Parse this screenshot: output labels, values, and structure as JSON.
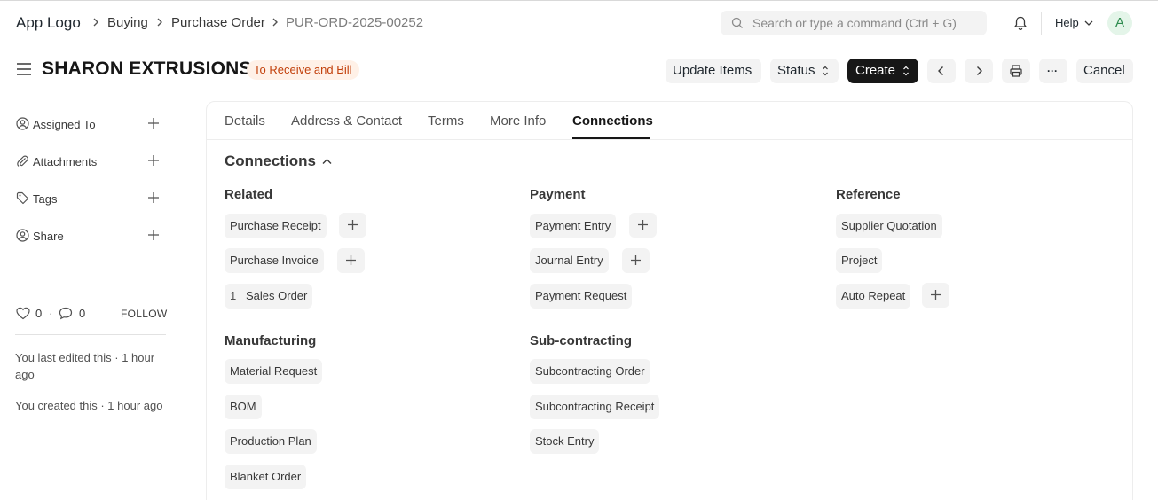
{
  "navbar": {
    "logo": "App Logo",
    "breadcrumbs": [
      "Buying",
      "Purchase Order",
      "PUR-ORD-2025-00252"
    ],
    "search_placeholder": "Search or type a command (Ctrl + G)",
    "help_label": "Help",
    "avatar_initial": "A"
  },
  "header": {
    "title": "SHARON EXTRUSIONS",
    "status": "To Receive and Bill",
    "buttons": {
      "update_items": "Update Items",
      "status": "Status",
      "create": "Create",
      "more": "···",
      "cancel": "Cancel"
    }
  },
  "sidebar": {
    "items": [
      {
        "label": "Assigned To",
        "icon": "assign-user-icon"
      },
      {
        "label": "Attachments",
        "icon": "paperclip-icon"
      },
      {
        "label": "Tags",
        "icon": "tag-icon"
      },
      {
        "label": "Share",
        "icon": "share-user-icon"
      }
    ],
    "likes_count": "0",
    "comments_count": "0",
    "separator": "·",
    "follow_label": "FOLLOW",
    "last_edited": "You last edited this · 1 hour ago",
    "created": "You created this · 1 hour ago"
  },
  "tabs": [
    "Details",
    "Address & Contact",
    "Terms",
    "More Info",
    "Connections"
  ],
  "active_tab": "Connections",
  "connections": {
    "title": "Connections",
    "groups": [
      {
        "title": "Related",
        "items": [
          {
            "label": "Purchase Receipt",
            "count": null,
            "addable": true
          },
          {
            "label": "Purchase Invoice",
            "count": null,
            "addable": true
          },
          {
            "label": "Sales Order",
            "count": "1",
            "addable": false
          }
        ]
      },
      {
        "title": "Payment",
        "items": [
          {
            "label": "Payment Entry",
            "count": null,
            "addable": true
          },
          {
            "label": "Journal Entry",
            "count": null,
            "addable": true
          },
          {
            "label": "Payment Request",
            "count": null,
            "addable": false
          }
        ]
      },
      {
        "title": "Reference",
        "items": [
          {
            "label": "Supplier Quotation",
            "count": null,
            "addable": false
          },
          {
            "label": "Project",
            "count": null,
            "addable": false
          },
          {
            "label": "Auto Repeat",
            "count": null,
            "addable": true
          }
        ]
      },
      {
        "title": "Manufacturing",
        "items": [
          {
            "label": "Material Request",
            "count": null,
            "addable": false
          },
          {
            "label": "BOM",
            "count": null,
            "addable": false
          },
          {
            "label": "Production Plan",
            "count": null,
            "addable": false
          },
          {
            "label": "Blanket Order",
            "count": null,
            "addable": false
          }
        ]
      },
      {
        "title": "Sub-contracting",
        "items": [
          {
            "label": "Subcontracting Order",
            "count": null,
            "addable": false
          },
          {
            "label": "Subcontracting Receipt",
            "count": null,
            "addable": false
          },
          {
            "label": "Stock Entry",
            "count": null,
            "addable": false
          }
        ]
      }
    ]
  }
}
